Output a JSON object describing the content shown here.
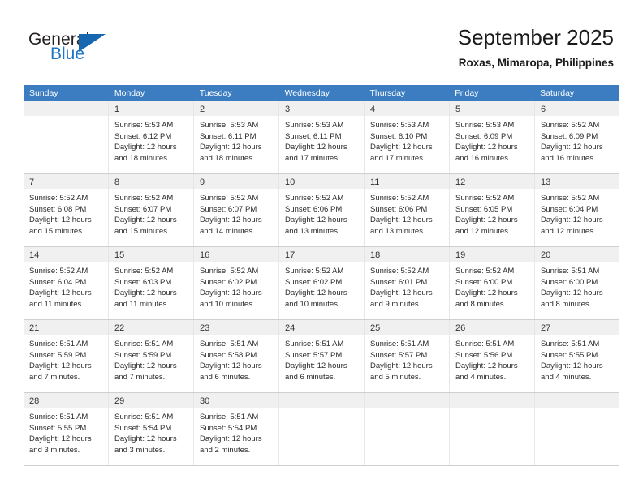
{
  "logo": {
    "text_general": "General",
    "text_blue": "Blue",
    "accent_color": "#1667b0"
  },
  "header": {
    "title": "September 2025",
    "subtitle": "Roxas, Mimaropa, Philippines"
  },
  "theme": {
    "header_row_color": "#3b7dc0",
    "daynum_bar_color": "#f0f0f0",
    "grid_line_color": "#cfcfcf"
  },
  "weekdays": [
    "Sunday",
    "Monday",
    "Tuesday",
    "Wednesday",
    "Thursday",
    "Friday",
    "Saturday"
  ],
  "weeks": [
    [
      {
        "day": "",
        "lines": []
      },
      {
        "day": "1",
        "lines": [
          "Sunrise: 5:53 AM",
          "Sunset: 6:12 PM",
          "Daylight: 12 hours",
          "and 18 minutes."
        ]
      },
      {
        "day": "2",
        "lines": [
          "Sunrise: 5:53 AM",
          "Sunset: 6:11 PM",
          "Daylight: 12 hours",
          "and 18 minutes."
        ]
      },
      {
        "day": "3",
        "lines": [
          "Sunrise: 5:53 AM",
          "Sunset: 6:11 PM",
          "Daylight: 12 hours",
          "and 17 minutes."
        ]
      },
      {
        "day": "4",
        "lines": [
          "Sunrise: 5:53 AM",
          "Sunset: 6:10 PM",
          "Daylight: 12 hours",
          "and 17 minutes."
        ]
      },
      {
        "day": "5",
        "lines": [
          "Sunrise: 5:53 AM",
          "Sunset: 6:09 PM",
          "Daylight: 12 hours",
          "and 16 minutes."
        ]
      },
      {
        "day": "6",
        "lines": [
          "Sunrise: 5:52 AM",
          "Sunset: 6:09 PM",
          "Daylight: 12 hours",
          "and 16 minutes."
        ]
      }
    ],
    [
      {
        "day": "7",
        "lines": [
          "Sunrise: 5:52 AM",
          "Sunset: 6:08 PM",
          "Daylight: 12 hours",
          "and 15 minutes."
        ]
      },
      {
        "day": "8",
        "lines": [
          "Sunrise: 5:52 AM",
          "Sunset: 6:07 PM",
          "Daylight: 12 hours",
          "and 15 minutes."
        ]
      },
      {
        "day": "9",
        "lines": [
          "Sunrise: 5:52 AM",
          "Sunset: 6:07 PM",
          "Daylight: 12 hours",
          "and 14 minutes."
        ]
      },
      {
        "day": "10",
        "lines": [
          "Sunrise: 5:52 AM",
          "Sunset: 6:06 PM",
          "Daylight: 12 hours",
          "and 13 minutes."
        ]
      },
      {
        "day": "11",
        "lines": [
          "Sunrise: 5:52 AM",
          "Sunset: 6:06 PM",
          "Daylight: 12 hours",
          "and 13 minutes."
        ]
      },
      {
        "day": "12",
        "lines": [
          "Sunrise: 5:52 AM",
          "Sunset: 6:05 PM",
          "Daylight: 12 hours",
          "and 12 minutes."
        ]
      },
      {
        "day": "13",
        "lines": [
          "Sunrise: 5:52 AM",
          "Sunset: 6:04 PM",
          "Daylight: 12 hours",
          "and 12 minutes."
        ]
      }
    ],
    [
      {
        "day": "14",
        "lines": [
          "Sunrise: 5:52 AM",
          "Sunset: 6:04 PM",
          "Daylight: 12 hours",
          "and 11 minutes."
        ]
      },
      {
        "day": "15",
        "lines": [
          "Sunrise: 5:52 AM",
          "Sunset: 6:03 PM",
          "Daylight: 12 hours",
          "and 11 minutes."
        ]
      },
      {
        "day": "16",
        "lines": [
          "Sunrise: 5:52 AM",
          "Sunset: 6:02 PM",
          "Daylight: 12 hours",
          "and 10 minutes."
        ]
      },
      {
        "day": "17",
        "lines": [
          "Sunrise: 5:52 AM",
          "Sunset: 6:02 PM",
          "Daylight: 12 hours",
          "and 10 minutes."
        ]
      },
      {
        "day": "18",
        "lines": [
          "Sunrise: 5:52 AM",
          "Sunset: 6:01 PM",
          "Daylight: 12 hours",
          "and 9 minutes."
        ]
      },
      {
        "day": "19",
        "lines": [
          "Sunrise: 5:52 AM",
          "Sunset: 6:00 PM",
          "Daylight: 12 hours",
          "and 8 minutes."
        ]
      },
      {
        "day": "20",
        "lines": [
          "Sunrise: 5:51 AM",
          "Sunset: 6:00 PM",
          "Daylight: 12 hours",
          "and 8 minutes."
        ]
      }
    ],
    [
      {
        "day": "21",
        "lines": [
          "Sunrise: 5:51 AM",
          "Sunset: 5:59 PM",
          "Daylight: 12 hours",
          "and 7 minutes."
        ]
      },
      {
        "day": "22",
        "lines": [
          "Sunrise: 5:51 AM",
          "Sunset: 5:59 PM",
          "Daylight: 12 hours",
          "and 7 minutes."
        ]
      },
      {
        "day": "23",
        "lines": [
          "Sunrise: 5:51 AM",
          "Sunset: 5:58 PM",
          "Daylight: 12 hours",
          "and 6 minutes."
        ]
      },
      {
        "day": "24",
        "lines": [
          "Sunrise: 5:51 AM",
          "Sunset: 5:57 PM",
          "Daylight: 12 hours",
          "and 6 minutes."
        ]
      },
      {
        "day": "25",
        "lines": [
          "Sunrise: 5:51 AM",
          "Sunset: 5:57 PM",
          "Daylight: 12 hours",
          "and 5 minutes."
        ]
      },
      {
        "day": "26",
        "lines": [
          "Sunrise: 5:51 AM",
          "Sunset: 5:56 PM",
          "Daylight: 12 hours",
          "and 4 minutes."
        ]
      },
      {
        "day": "27",
        "lines": [
          "Sunrise: 5:51 AM",
          "Sunset: 5:55 PM",
          "Daylight: 12 hours",
          "and 4 minutes."
        ]
      }
    ],
    [
      {
        "day": "28",
        "lines": [
          "Sunrise: 5:51 AM",
          "Sunset: 5:55 PM",
          "Daylight: 12 hours",
          "and 3 minutes."
        ]
      },
      {
        "day": "29",
        "lines": [
          "Sunrise: 5:51 AM",
          "Sunset: 5:54 PM",
          "Daylight: 12 hours",
          "and 3 minutes."
        ]
      },
      {
        "day": "30",
        "lines": [
          "Sunrise: 5:51 AM",
          "Sunset: 5:54 PM",
          "Daylight: 12 hours",
          "and 2 minutes."
        ]
      },
      {
        "day": "",
        "lines": []
      },
      {
        "day": "",
        "lines": []
      },
      {
        "day": "",
        "lines": []
      },
      {
        "day": "",
        "lines": []
      }
    ]
  ]
}
